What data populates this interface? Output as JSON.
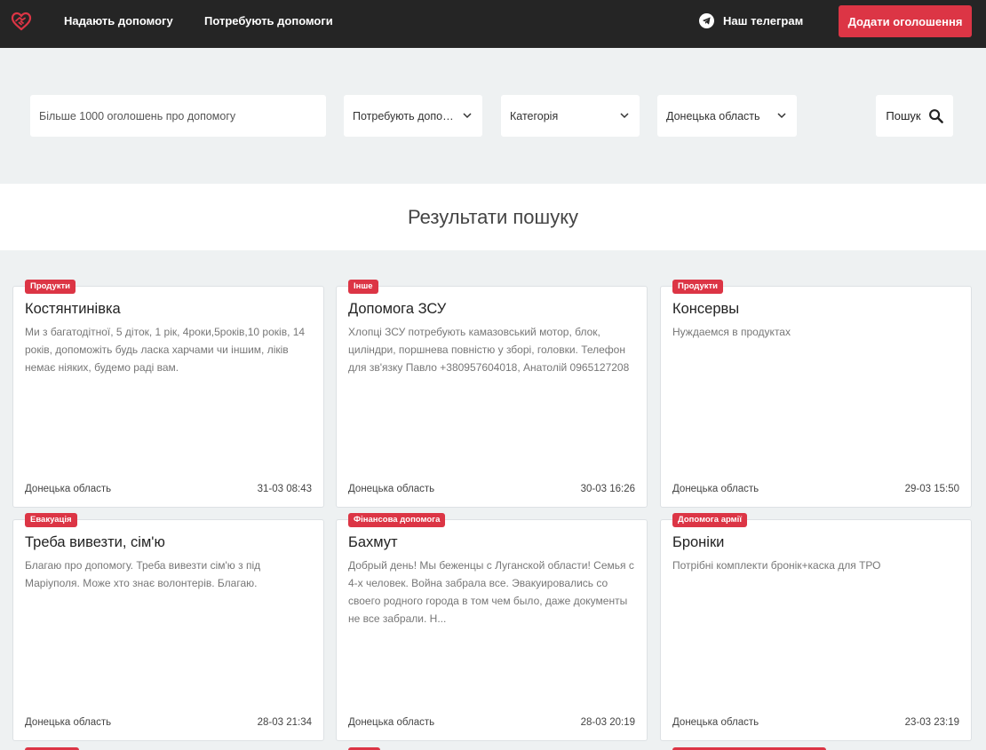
{
  "nav": {
    "give_help": "Надають допомогу",
    "need_help": "Потребують допомоги",
    "telegram": "Наш телеграм",
    "add_listing": "Додати оголошення"
  },
  "search": {
    "placeholder": "Більше 1000 оголошень про допомогу",
    "type_selected": "Потребують допомоги",
    "category_selected": "Категорія",
    "region_selected": "Донецька область",
    "button_label": "Пошук"
  },
  "results": {
    "title": "Результати пошуку"
  },
  "cards": [
    {
      "badge": "Продукти",
      "title": "Костянтинівка",
      "description": "Ми з багатодітної, 5 діток, 1 рік, 4роки,5років,10 років, 14 років, допоможіть будь ласка харчами чи іншим, ліків немає ніяких, будемо раді вам.",
      "region": "Донецька область",
      "date": "31-03 08:43"
    },
    {
      "badge": "Інше",
      "title": "Допомога ЗСУ",
      "description": "Хлопці ЗСУ потребують камазовський мотор, блок, циліндри, поршнева повністю у зборі, головки. Телефон для зв'язку Павло +380957604018, Анатолій 0965127208",
      "region": "Донецька область",
      "date": "30-03 16:26"
    },
    {
      "badge": "Продукти",
      "title": "Консервы",
      "description": "Нуждаемся в продуктах",
      "region": "Донецька область",
      "date": "29-03 15:50"
    },
    {
      "badge": "Евакуація",
      "title": "Треба вивезти, сім'ю",
      "description": "Благаю про допомогу. Треба вивезти сім'ю з під Маріуполя. Може хто знає волонтерів. Благаю.",
      "region": "Донецька область",
      "date": "28-03 21:34"
    },
    {
      "badge": "Фінансова допомога",
      "title": "Бахмут",
      "description": "Добрый день! Мы беженцы с Луганской области! Семья с 4-х человек. Война забрала все. Эвакуировались со своего родного города в том чем было, даже документы не все забрали. Н...",
      "region": "Донецька область",
      "date": "28-03 20:19"
    },
    {
      "badge": "Допомога армії",
      "title": "Броніки",
      "description": "Потрібні комплекти бронік+каска для ТРО",
      "region": "Донецька область",
      "date": "23-03 23:19"
    }
  ],
  "colors": {
    "accent": "#dc3545",
    "topbar": "#252525",
    "background": "#eef1f2"
  }
}
